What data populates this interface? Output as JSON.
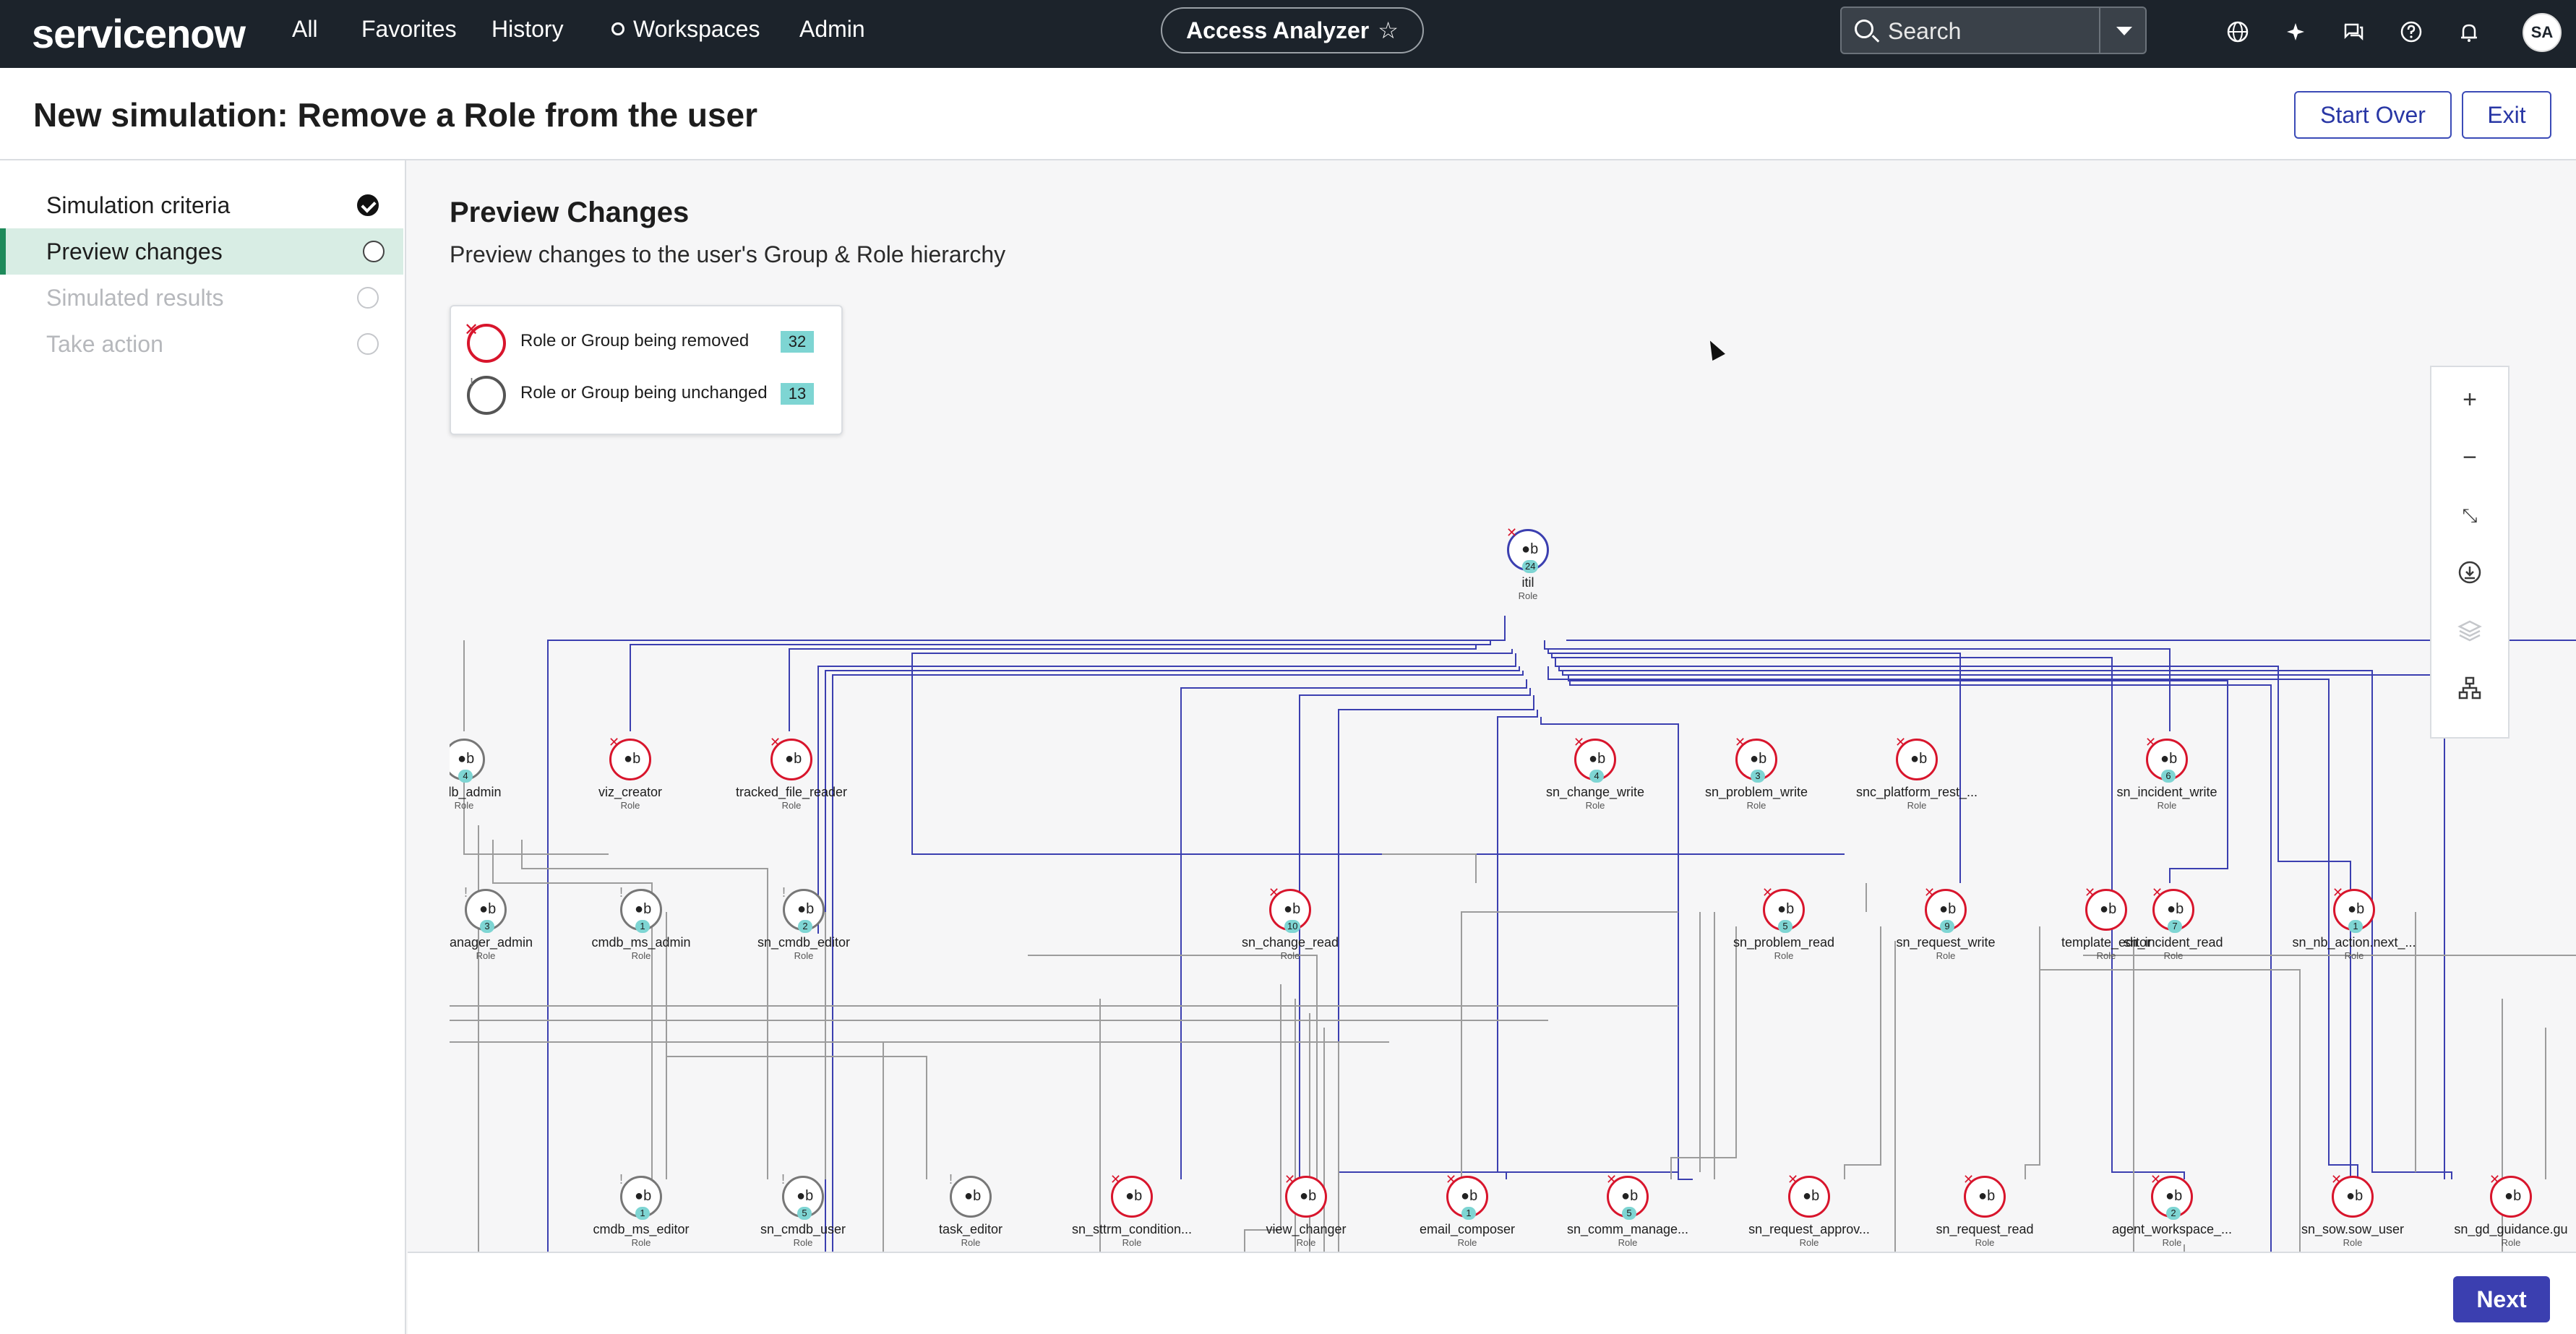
{
  "nav": {
    "brand": "servicenow",
    "links": [
      "All",
      "Favorites",
      "History",
      "Workspaces",
      "Admin"
    ],
    "app_pill": "Access Analyzer",
    "pill_star": "☆",
    "search_placeholder": "Search",
    "avatar": "SA",
    "icons": [
      "globe-icon",
      "sparkle-icon",
      "chat-icon",
      "help-icon",
      "bell-icon"
    ]
  },
  "header": {
    "title": "New simulation: Remove a Role from the user",
    "start_over": "Start Over",
    "exit": "Exit"
  },
  "sidebar": {
    "steps": [
      {
        "label": "Simulation criteria",
        "state": "done"
      },
      {
        "label": "Preview changes",
        "state": "active"
      },
      {
        "label": "Simulated results",
        "state": "disabled"
      },
      {
        "label": "Take action",
        "state": "disabled"
      }
    ]
  },
  "main": {
    "title": "Preview Changes",
    "subtitle": "Preview changes to the user's Group & Role hierarchy"
  },
  "legend": {
    "removed_label": "Role or Group being removed",
    "removed_count": "32",
    "unchanged_label": "Role or Group being unchanged",
    "unchanged_count": "13"
  },
  "graph": {
    "nodes": [
      {
        "id": "itil",
        "name": "itil",
        "type": "Role",
        "status": "removed",
        "count": "24"
      },
      {
        "id": "cmdb_admin",
        "name": "cmdb_admin",
        "type": "Role",
        "status": "unchanged",
        "count": "4"
      },
      {
        "id": "viz_creator",
        "name": "viz_creator",
        "type": "Role",
        "status": "removed",
        "count": ""
      },
      {
        "id": "tracked_file_reader",
        "name": "tracked_file_reader",
        "type": "Role",
        "status": "removed",
        "count": ""
      },
      {
        "id": "sn_change_write",
        "name": "sn_change_write",
        "type": "Role",
        "status": "removed",
        "count": "4"
      },
      {
        "id": "sn_problem_write",
        "name": "sn_problem_write",
        "type": "Role",
        "status": "removed",
        "count": "3"
      },
      {
        "id": "snc_platform_rest",
        "name": "snc_platform_rest_...",
        "type": "Role",
        "status": "removed",
        "count": ""
      },
      {
        "id": "sn_incident_write",
        "name": "sn_incident_write",
        "type": "Role",
        "status": "removed",
        "count": "6"
      },
      {
        "id": "manager_admin",
        "name": "manager_admin",
        "type": "Role",
        "status": "unchanged",
        "count": "3"
      },
      {
        "id": "cmdb_ms_admin",
        "name": "cmdb_ms_admin",
        "type": "Role",
        "status": "unchanged",
        "count": "1"
      },
      {
        "id": "sn_cmdb_editor",
        "name": "sn_cmdb_editor",
        "type": "Role",
        "status": "unchanged",
        "count": "2"
      },
      {
        "id": "sn_change_read",
        "name": "sn_change_read",
        "type": "Role",
        "status": "removed",
        "count": "10"
      },
      {
        "id": "sn_problem_read",
        "name": "sn_problem_read",
        "type": "Role",
        "status": "removed",
        "count": "5"
      },
      {
        "id": "sn_request_write",
        "name": "sn_request_write",
        "type": "Role",
        "status": "removed",
        "count": "9"
      },
      {
        "id": "template_editor",
        "name": "template_editor",
        "type": "Role",
        "status": "removed",
        "count": ""
      },
      {
        "id": "sn_incident_read",
        "name": "sn_incident_read",
        "type": "Role",
        "status": "removed",
        "count": "7"
      },
      {
        "id": "sn_nb_action",
        "name": "sn_nb_action.next_...",
        "type": "Role",
        "status": "removed",
        "count": "1"
      },
      {
        "id": "cmdb_ms_editor",
        "name": "cmdb_ms_editor",
        "type": "Role",
        "status": "unchanged",
        "count": "1"
      },
      {
        "id": "sn_cmdb_user",
        "name": "sn_cmdb_user",
        "type": "Role",
        "status": "unchanged",
        "count": "5"
      },
      {
        "id": "task_editor",
        "name": "task_editor",
        "type": "Role",
        "status": "unchanged",
        "count": ""
      },
      {
        "id": "sn_sttrm_condition",
        "name": "sn_sttrm_condition...",
        "type": "Role",
        "status": "removed",
        "count": ""
      },
      {
        "id": "view_changer",
        "name": "view_changer",
        "type": "Role",
        "status": "removed",
        "count": ""
      },
      {
        "id": "email_composer",
        "name": "email_composer",
        "type": "Role",
        "status": "removed",
        "count": "1"
      },
      {
        "id": "sn_comm_manage",
        "name": "sn_comm_manage...",
        "type": "Role",
        "status": "removed",
        "count": "5"
      },
      {
        "id": "sn_request_approv",
        "name": "sn_request_approv...",
        "type": "Role",
        "status": "removed",
        "count": ""
      },
      {
        "id": "sn_request_read",
        "name": "sn_request_read",
        "type": "Role",
        "status": "removed",
        "count": ""
      },
      {
        "id": "agent_workspace",
        "name": "agent_workspace_...",
        "type": "Role",
        "status": "removed",
        "count": "2"
      },
      {
        "id": "sn_sow_sow_user",
        "name": "sn_sow.sow_user",
        "type": "Role",
        "status": "removed",
        "count": ""
      },
      {
        "id": "sn_gd_guidance",
        "name": "sn_gd_guidance.gu",
        "type": "Role",
        "status": "removed",
        "count": ""
      }
    ]
  },
  "zoom_tools": [
    "zoom-in-icon",
    "zoom-out-icon",
    "fit-icon",
    "download-icon",
    "layers-icon",
    "hierarchy-icon"
  ],
  "footer": {
    "next": "Next"
  }
}
